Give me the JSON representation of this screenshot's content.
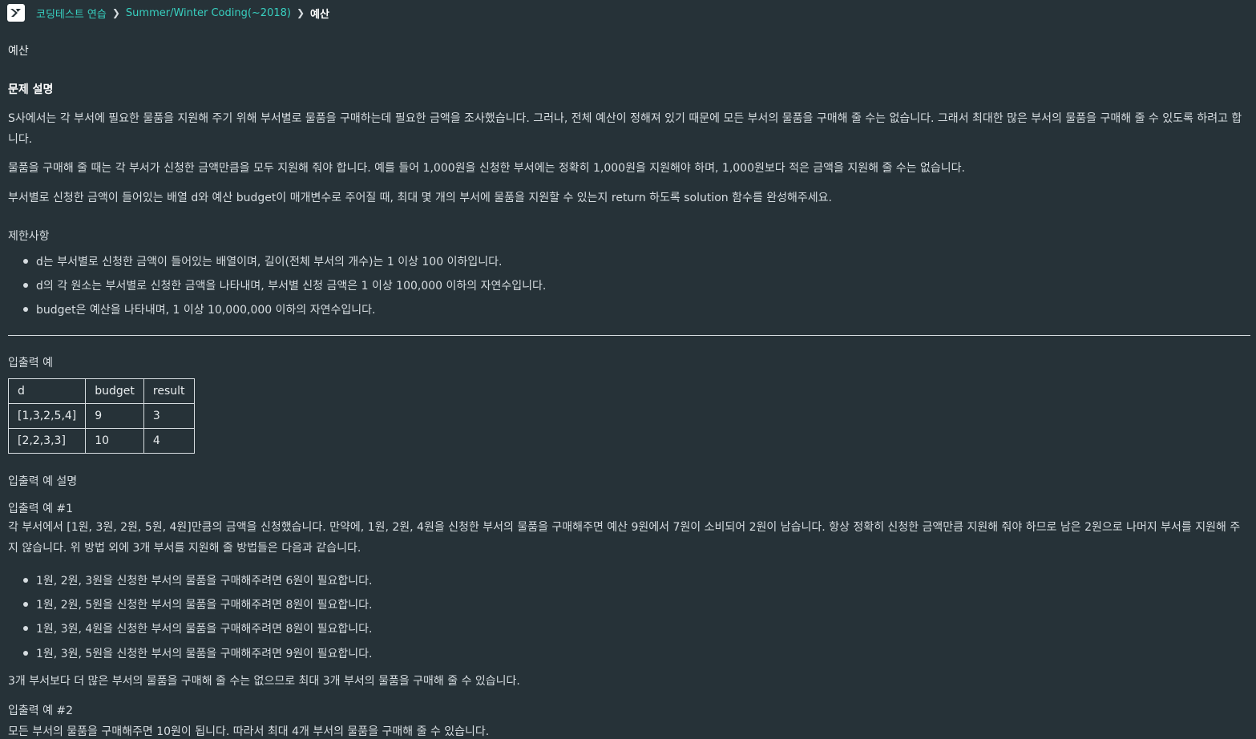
{
  "breadcrumb": {
    "items": [
      "코딩테스트 연습",
      "Summer/Winter Coding(~2018)"
    ],
    "current": "예산"
  },
  "problem": {
    "title": "예산",
    "section_desc": "문제 설명",
    "desc_p1": "S사에서는 각 부서에 필요한 물품을 지원해 주기 위해 부서별로 물품을 구매하는데 필요한 금액을 조사했습니다. 그러나, 전체 예산이 정해져 있기 때문에 모든 부서의 물품을 구매해 줄 수는 없습니다. 그래서 최대한 많은 부서의 물품을 구매해 줄 수 있도록 하려고 합니다.",
    "desc_p2": "물품을 구매해 줄 때는 각 부서가 신청한 금액만큼을 모두 지원해 줘야 합니다. 예를 들어 1,000원을 신청한 부서에는 정확히 1,000원을 지원해야 하며, 1,000원보다 적은 금액을 지원해 줄 수는 없습니다.",
    "desc_p3": "부서별로 신청한 금액이 들어있는 배열 d와 예산 budget이 매개변수로 주어질 때, 최대 몇 개의 부서에 물품을 지원할 수 있는지 return 하도록 solution 함수를 완성해주세요.",
    "section_constraints": "제한사항",
    "constraints": [
      "d는 부서별로 신청한 금액이 들어있는 배열이며, 길이(전체 부서의 개수)는 1 이상 100 이하입니다.",
      "d의 각 원소는 부서별로 신청한 금액을 나타내며, 부서별 신청 금액은 1 이상 100,000 이하의 자연수입니다.",
      "budget은 예산을 나타내며, 1 이상 10,000,000 이하의 자연수입니다."
    ],
    "section_examples": "입출력 예",
    "table": {
      "headers": [
        "d",
        "budget",
        "result"
      ],
      "rows": [
        [
          "[1,3,2,5,4]",
          "9",
          "3"
        ],
        [
          "[2,2,3,3]",
          "10",
          "4"
        ]
      ]
    },
    "section_examples_desc": "입출력 예 설명",
    "ex1_title": "입출력 예 #1",
    "ex1_text": "각 부서에서 [1원, 3원, 2원, 5원, 4원]만큼의 금액을 신청했습니다. 만약에, 1원, 2원, 4원을 신청한 부서의 물품을 구매해주면 예산 9원에서 7원이 소비되어 2원이 남습니다. 항상 정확히 신청한 금액만큼 지원해 줘야 하므로 남은 2원으로 나머지 부서를 지원해 주지 않습니다. 위 방법 외에 3개 부서를 지원해 줄 방법들은 다음과 같습니다.",
    "ex1_items": [
      "1원, 2원, 3원을 신청한 부서의 물품을 구매해주려면 6원이 필요합니다.",
      "1원, 2원, 5원을 신청한 부서의 물품을 구매해주려면 8원이 필요합니다.",
      "1원, 3원, 4원을 신청한 부서의 물품을 구매해주려면 8원이 필요합니다.",
      "1원, 3원, 5원을 신청한 부서의 물품을 구매해주려면 9원이 필요합니다."
    ],
    "ex1_conclusion": "3개 부서보다 더 많은 부서의 물품을 구매해 줄 수는 없으므로 최대 3개 부서의 물품을 구매해 줄 수 있습니다.",
    "ex2_title": "입출력 예 #2",
    "ex2_text": "모든 부서의 물품을 구매해주면 10원이 됩니다. 따라서 최대 4개 부서의 물품을 구매해 줄 수 있습니다."
  }
}
